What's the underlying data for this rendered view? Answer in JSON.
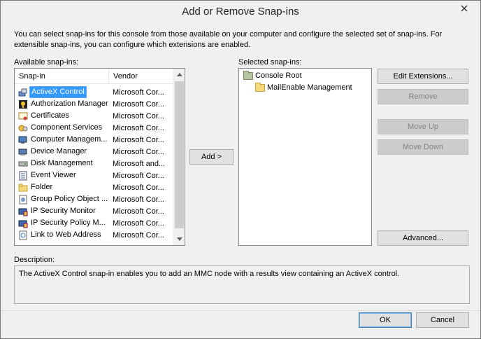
{
  "window": {
    "title": "Add or Remove Snap-ins",
    "intro": "You can select snap-ins for this console from those available on your computer and configure the selected set of snap-ins. For extensible snap-ins, you can configure which extensions are enabled."
  },
  "available": {
    "label": "Available snap-ins:",
    "columns": {
      "snapin": "Snap-in",
      "vendor": "Vendor"
    },
    "items": [
      {
        "name": "ActiveX Control",
        "vendor": "Microsoft Cor...",
        "icon": "activex-icon",
        "selected": true
      },
      {
        "name": "Authorization Manager",
        "vendor": "Microsoft Cor...",
        "icon": "authorization-icon"
      },
      {
        "name": "Certificates",
        "vendor": "Microsoft Cor...",
        "icon": "certificate-icon"
      },
      {
        "name": "Component Services",
        "vendor": "Microsoft Cor...",
        "icon": "component-services-icon"
      },
      {
        "name": "Computer Managem...",
        "vendor": "Microsoft Cor...",
        "icon": "computer-management-icon"
      },
      {
        "name": "Device Manager",
        "vendor": "Microsoft Cor...",
        "icon": "device-manager-icon"
      },
      {
        "name": "Disk Management",
        "vendor": "Microsoft and...",
        "icon": "disk-icon"
      },
      {
        "name": "Event Viewer",
        "vendor": "Microsoft Cor...",
        "icon": "event-viewer-icon"
      },
      {
        "name": "Folder",
        "vendor": "Microsoft Cor...",
        "icon": "folder-icon"
      },
      {
        "name": "Group Policy Object ...",
        "vendor": "Microsoft Cor...",
        "icon": "group-policy-icon"
      },
      {
        "name": "IP Security Monitor",
        "vendor": "Microsoft Cor...",
        "icon": "ip-security-icon"
      },
      {
        "name": "IP Security Policy M...",
        "vendor": "Microsoft Cor...",
        "icon": "ip-security-policy-icon"
      },
      {
        "name": "Link to Web Address",
        "vendor": "Microsoft Cor...",
        "icon": "web-link-icon"
      }
    ]
  },
  "add_button": "Add >",
  "selected": {
    "label": "Selected snap-ins:",
    "root": "Console Root",
    "child": "MailEnable Management"
  },
  "buttons": {
    "edit_extensions": "Edit Extensions...",
    "remove": "Remove",
    "move_up": "Move Up",
    "move_down": "Move Down",
    "advanced": "Advanced...",
    "ok": "OK",
    "cancel": "Cancel"
  },
  "description": {
    "label": "Description:",
    "text": "The ActiveX Control snap-in enables you to add an MMC node with a results view containing an ActiveX control."
  }
}
